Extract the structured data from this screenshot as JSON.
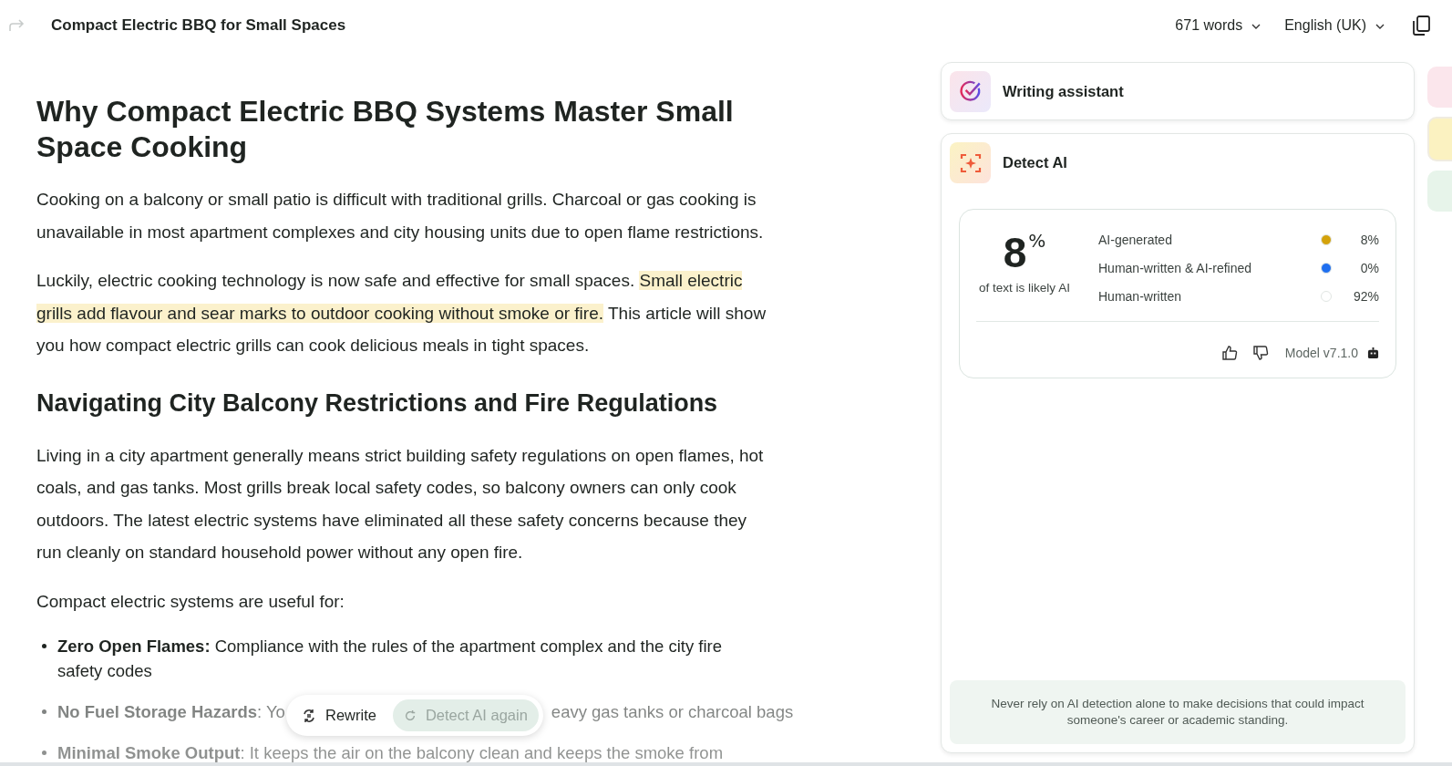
{
  "header": {
    "title": "Compact Electric BBQ for Small Spaces",
    "word_count": "671 words",
    "language": "English (UK)"
  },
  "document": {
    "title": "Why Compact Electric BBQ Systems Master Small Space Cooking",
    "paragraphs": [
      [
        {
          "text": "Cooking on a balcony or small patio is difficult with traditional grills. Charcoal or gas cooking is unavailable in most apartment complexes and city housing units due to open flame restrictions.",
          "highlighted": false
        }
      ],
      [
        {
          "text": "Luckily, electric cooking technology is now safe and effective for small spaces. ",
          "highlighted": false
        },
        {
          "text": "Small electric grills add flavour and sear marks to outdoor cooking without smoke or fire.",
          "highlighted": true
        },
        {
          "text": " This article will show you how compact electric grills can cook delicious meals in tight spaces.",
          "highlighted": false
        }
      ]
    ],
    "heading": "Navigating City Balcony Restrictions and Fire Regulations",
    "paragraphs_2": [
      "Living in a city apartment generally means strict building safety regulations on open flames, hot coals, and gas tanks. Most grills break local safety codes, so balcony owners can only cook outdoors. The latest electric systems have eliminated all these safety concerns because they run cleanly on standard household power without any open fire.",
      "Compact electric systems are useful for:"
    ],
    "bullets": [
      {
        "lead": "Zero Open Flames:",
        "text": " Compliance with the rules of the apartment complex and the city fire safety codes"
      },
      {
        "lead": "No Fuel Storage Hazards",
        "text": ": Yo",
        "text_after": "eavy gas tanks or charcoal bags"
      },
      {
        "lead": "Minimal Smoke Output",
        "text": ": It keeps the air on the balcony clean and keeps the smoke from"
      }
    ]
  },
  "toolbar": {
    "rewrite": "Rewrite",
    "detect_again": {
      "label": "Detect AI again",
      "disabled": true
    }
  },
  "panel": {
    "writing_assistant": "Writing assistant",
    "detect_ai": {
      "title": "Detect AI",
      "score": "8",
      "score_unit": "%",
      "score_caption": "of text is likely AI",
      "rows": [
        {
          "label": "AI-generated",
          "color": "#d4a20a",
          "value": "8%"
        },
        {
          "label": "Human-written & AI-refined",
          "color": "#1f6ff0",
          "value": "0%"
        },
        {
          "label": "Human-written",
          "color": "#ffffff",
          "value": "92%"
        }
      ],
      "model": "Model v7.1.0",
      "disclaimer": "Never rely on AI detection alone to make decisions that could impact someone's career or academic standing."
    }
  }
}
